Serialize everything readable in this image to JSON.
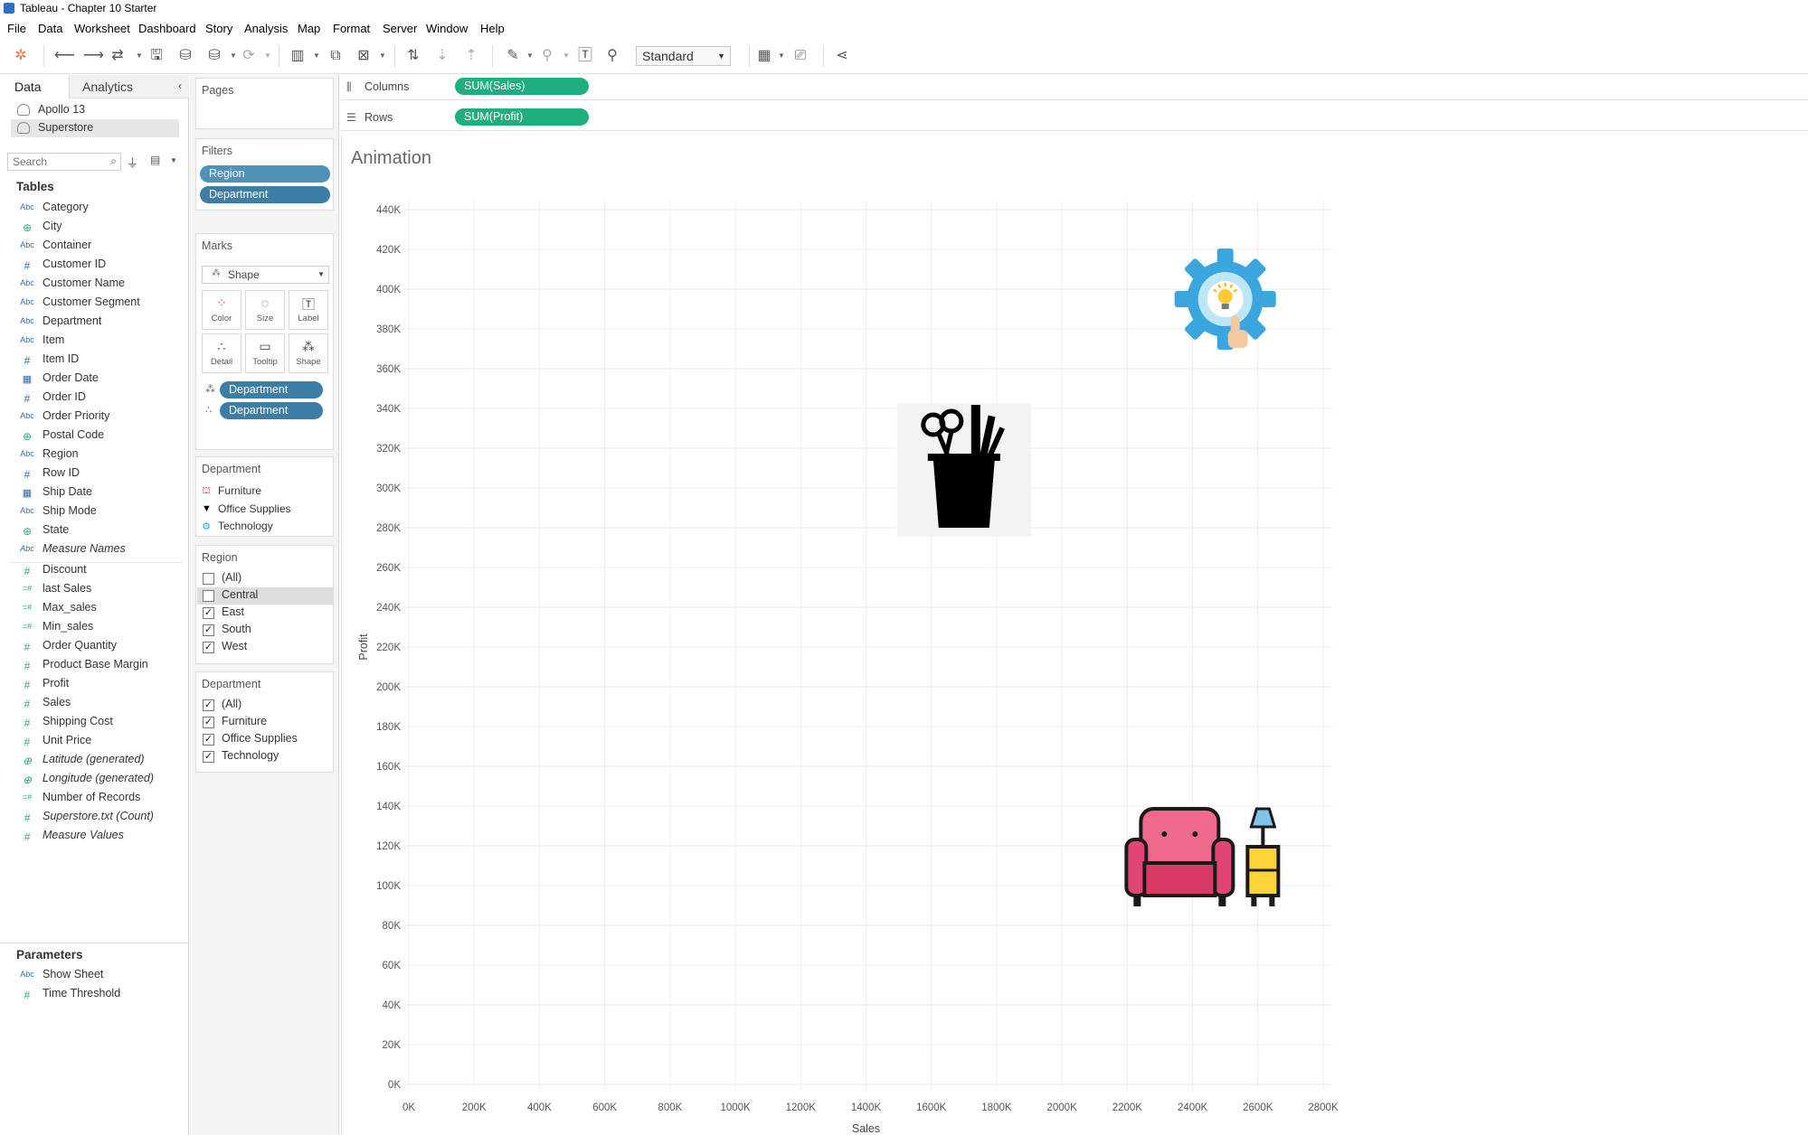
{
  "window": {
    "title": "Tableau - Chapter 10 Starter"
  },
  "menu": [
    "File",
    "Data",
    "Worksheet",
    "Dashboard",
    "Story",
    "Analysis",
    "Map",
    "Format",
    "Server",
    "Window",
    "Help"
  ],
  "toolbar": {
    "fit_value": "Standard"
  },
  "data_pane": {
    "tabs": [
      "Data",
      "Analytics"
    ],
    "collapse_icon": "chevron-left-icon",
    "datasources": [
      "Apollo 13",
      "Superstore"
    ],
    "search_placeholder": "Search",
    "tables_header": "Tables",
    "dimensions": [
      {
        "name": "Category",
        "type": "Abc"
      },
      {
        "name": "City",
        "type": "geo"
      },
      {
        "name": "Container",
        "type": "Abc"
      },
      {
        "name": "Customer ID",
        "type": "#"
      },
      {
        "name": "Customer Name",
        "type": "Abc"
      },
      {
        "name": "Customer Segment",
        "type": "Abc"
      },
      {
        "name": "Department",
        "type": "Abc"
      },
      {
        "name": "Item",
        "type": "Abc"
      },
      {
        "name": "Item ID",
        "type": "#"
      },
      {
        "name": "Order Date",
        "type": "date"
      },
      {
        "name": "Order ID",
        "type": "#"
      },
      {
        "name": "Order Priority",
        "type": "Abc"
      },
      {
        "name": "Postal Code",
        "type": "geo"
      },
      {
        "name": "Region",
        "type": "Abc"
      },
      {
        "name": "Row ID",
        "type": "#"
      },
      {
        "name": "Ship Date",
        "type": "date"
      },
      {
        "name": "Ship Mode",
        "type": "Abc"
      },
      {
        "name": "State",
        "type": "geo"
      },
      {
        "name": "Measure Names",
        "type": "Abc",
        "italic": true
      }
    ],
    "measures": [
      {
        "name": "Discount",
        "type": "#"
      },
      {
        "name": "last Sales",
        "type": "=#"
      },
      {
        "name": "Max_sales",
        "type": "=#"
      },
      {
        "name": "Min_sales",
        "type": "=#"
      },
      {
        "name": "Order Quantity",
        "type": "#"
      },
      {
        "name": "Product Base Margin",
        "type": "#"
      },
      {
        "name": "Profit",
        "type": "#"
      },
      {
        "name": "Sales",
        "type": "#"
      },
      {
        "name": "Shipping Cost",
        "type": "#"
      },
      {
        "name": "Unit Price",
        "type": "#"
      },
      {
        "name": "Latitude (generated)",
        "type": "geo",
        "italic": true
      },
      {
        "name": "Longitude (generated)",
        "type": "geo",
        "italic": true
      },
      {
        "name": "Number of Records",
        "type": "=#"
      },
      {
        "name": "Superstore.txt (Count)",
        "type": "#",
        "italic": true
      },
      {
        "name": "Measure Values",
        "type": "#",
        "italic": true
      }
    ],
    "parameters_header": "Parameters",
    "parameters": [
      {
        "name": "Show Sheet",
        "type": "Abc"
      },
      {
        "name": "Time Threshold",
        "type": "#"
      }
    ]
  },
  "cards": {
    "pages_title": "Pages",
    "filters_title": "Filters",
    "filters": [
      "Region",
      "Department"
    ],
    "marks_title": "Marks",
    "mark_type": "Shape",
    "mark_buttons": [
      "Color",
      "Size",
      "Label",
      "Detail",
      "Tooltip",
      "Shape"
    ],
    "mark_pills": [
      "Department",
      "Department"
    ],
    "shape_legend": {
      "title": "Department",
      "items": [
        "Furniture",
        "Office Supplies",
        "Technology"
      ]
    },
    "region_filter": {
      "title": "Region",
      "items": [
        {
          "label": "(All)",
          "checked": false
        },
        {
          "label": "Central",
          "checked": false,
          "highlight": true
        },
        {
          "label": "East",
          "checked": true
        },
        {
          "label": "South",
          "checked": true
        },
        {
          "label": "West",
          "checked": true
        }
      ]
    },
    "department_filter": {
      "title": "Department",
      "items": [
        {
          "label": "(All)",
          "checked": true
        },
        {
          "label": "Furniture",
          "checked": true
        },
        {
          "label": "Office Supplies",
          "checked": true
        },
        {
          "label": "Technology",
          "checked": true
        }
      ]
    }
  },
  "shelves": {
    "columns_label": "Columns",
    "columns_pill": "SUM(Sales)",
    "rows_label": "Rows",
    "rows_pill": "SUM(Profit)"
  },
  "sheet": {
    "title": "Animation"
  },
  "chart_data": {
    "type": "scatter",
    "xlabel": "Sales",
    "ylabel": "Profit",
    "xlim": [
      0,
      2800000
    ],
    "ylim": [
      0,
      440000
    ],
    "x_ticks": [
      "0K",
      "200K",
      "400K",
      "600K",
      "800K",
      "1000K",
      "1200K",
      "1400K",
      "1600K",
      "1800K",
      "2000K",
      "2200K",
      "2400K",
      "2600K",
      "2800K"
    ],
    "y_ticks": [
      "0K",
      "20K",
      "40K",
      "60K",
      "80K",
      "100K",
      "120K",
      "140K",
      "160K",
      "180K",
      "200K",
      "220K",
      "240K",
      "260K",
      "280K",
      "300K",
      "320K",
      "340K",
      "360K",
      "380K",
      "400K",
      "420K",
      "440K"
    ],
    "grid": true,
    "points": [
      {
        "department": "Technology",
        "x": 2500000,
        "y": 395000,
        "shape": "gear-lightbulb-icon"
      },
      {
        "department": "Office Supplies",
        "x": 1700000,
        "y": 310000,
        "shape": "pencil-cup-icon"
      },
      {
        "department": "Furniture",
        "x": 2380000,
        "y": 115000,
        "shape": "armchair-lamp-icon"
      }
    ]
  }
}
